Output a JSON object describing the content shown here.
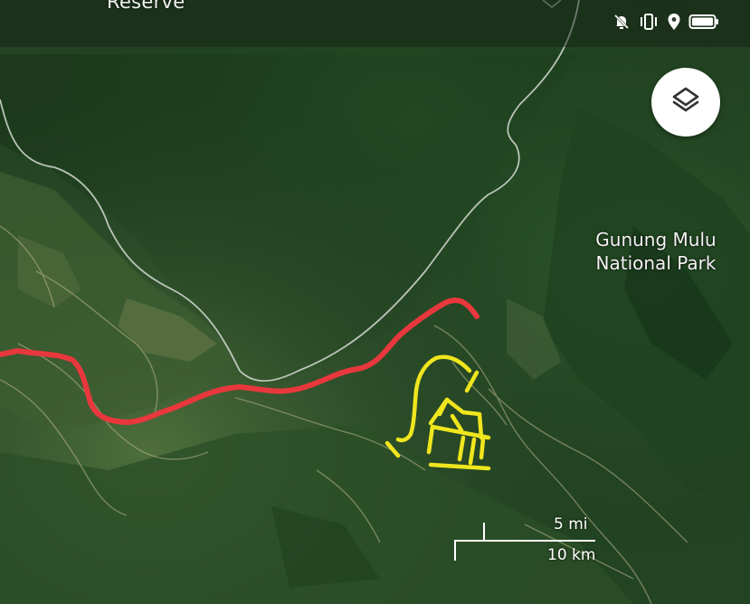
{
  "map": {
    "top_label": "Reserve",
    "place_label_line1": "Gunung Mulu",
    "place_label_line2": "National Park",
    "scale": {
      "miles_label": "5 mi",
      "km_label": "10 km"
    }
  },
  "status_bar": {
    "icons": [
      "notifications-off-icon",
      "vibrate-icon",
      "location-icon",
      "battery-icon"
    ]
  },
  "controls": {
    "layers_icon": "layers-icon"
  },
  "colors": {
    "red_route": "#e8383d",
    "yellow_marks": "#f0e61e",
    "boundary_line": "#cfd6cf",
    "forest_dark": "#1e3d1d",
    "forest_mid": "#2b5128"
  }
}
